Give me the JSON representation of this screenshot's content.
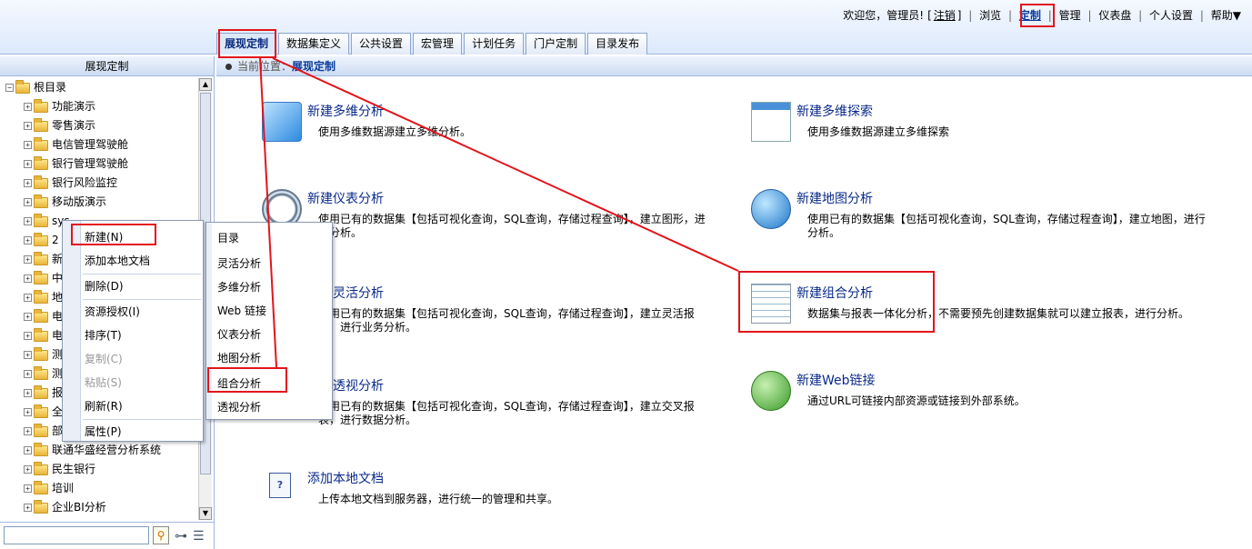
{
  "header": {
    "welcome": "欢迎您，管理员!",
    "logout_open": "[",
    "logout": "注销",
    "logout_close": "]",
    "links": [
      "浏览",
      "定制",
      "管理",
      "仪表盘",
      "个人设置",
      "帮助▼"
    ],
    "active_link": "定制"
  },
  "tabs": [
    "展现定制",
    "数据集定义",
    "公共设置",
    "宏管理",
    "计划任务",
    "门户定制",
    "目录发布"
  ],
  "active_tab": "展现定制",
  "sidebar": {
    "title": "展现定制",
    "tree": [
      {
        "label": "根目录",
        "expander": "⊟",
        "level": 0
      },
      {
        "label": "功能演示",
        "expander": "⊞",
        "level": 1
      },
      {
        "label": "零售演示",
        "expander": "⊞",
        "level": 1
      },
      {
        "label": "电信管理驾驶舱",
        "expander": "⊞",
        "level": 1
      },
      {
        "label": "银行管理驾驶舱",
        "expander": "⊞",
        "level": 1
      },
      {
        "label": "银行风险监控",
        "expander": "⊞",
        "level": 1
      },
      {
        "label": "移动版演示",
        "expander": "⊞",
        "level": 1
      },
      {
        "label": "sys...",
        "expander": "⊞",
        "level": 1
      },
      {
        "label": "2",
        "expander": "⊞",
        "level": 1
      },
      {
        "label": "新",
        "expander": "⊞",
        "level": 1
      },
      {
        "label": "中",
        "expander": "⊞",
        "level": 1
      },
      {
        "label": "地",
        "expander": "⊞",
        "level": 1
      },
      {
        "label": "电",
        "expander": "⊞",
        "level": 1
      },
      {
        "label": "电",
        "expander": "⊞",
        "level": 1
      },
      {
        "label": "测",
        "expander": "⊞",
        "level": 1
      },
      {
        "label": "测",
        "expander": "⊞",
        "level": 1
      },
      {
        "label": "报",
        "expander": "⊞",
        "level": 1
      },
      {
        "label": "全",
        "expander": "⊞",
        "level": 1
      },
      {
        "label": "部",
        "expander": "⊞",
        "level": 1
      },
      {
        "label": "联通华盛经营分析系统",
        "expander": "⊞",
        "level": 1
      },
      {
        "label": "民生银行",
        "expander": "⊞",
        "level": 1
      },
      {
        "label": "培训",
        "expander": "⊞",
        "level": 1
      },
      {
        "label": "企业BI分析",
        "expander": "⊞",
        "level": 1
      }
    ]
  },
  "breadcrumb": {
    "label": "当前位置：",
    "current": "展现定制"
  },
  "cards": [
    {
      "title": "新建多维分析",
      "desc": "使用多维数据源建立多维分析。",
      "icon": "olap-cube-icon"
    },
    {
      "title": "新建多维探索",
      "desc": "使用多维数据源建立多维探索",
      "icon": "explore-window-icon"
    },
    {
      "title": "新建仪表分析",
      "desc": "使用已有的数据集【包括可视化查询，SQL查询，存储过程查询】，建立图形，进行分析。",
      "icon": "gauge-icon"
    },
    {
      "title": "新建地图分析",
      "desc": "使用已有的数据集【包括可视化查询，SQL查询，存储过程查询】，建立地图，进行分析。",
      "icon": "globe-icon"
    },
    {
      "title": "新建灵活分析",
      "desc": "使用已有的数据集【包括可视化查询，SQL查询，存储过程查询】，建立灵活报表，进行业务分析。",
      "icon": "flexible-icon"
    },
    {
      "title": "新建组合分析",
      "desc": "数据集与报表一体化分析，不需要预先创建数据集就可以建立报表，进行分析。",
      "icon": "combo-grid-icon"
    },
    {
      "title": "新建透视分析",
      "desc": "使用已有的数据集【包括可视化查询，SQL查询，存储过程查询】，建立交叉报表，进行数据分析。",
      "icon": "pivot-icon"
    },
    {
      "title": "新建Web链接",
      "desc": "通过URL可链接内部资源或链接到外部系统。",
      "icon": "web-link-icon"
    },
    {
      "title": "添加本地文档",
      "desc": "上传本地文档到服务器，进行统一的管理和共享。",
      "icon": "local-doc-icon"
    }
  ],
  "context_menu": [
    {
      "label": "新建(N)",
      "disabled": false
    },
    {
      "label": "添加本地文档",
      "disabled": false
    },
    {
      "label": "删除(D)",
      "disabled": false
    },
    {
      "label": "资源授权(I)",
      "disabled": false
    },
    {
      "label": "排序(T)",
      "disabled": false
    },
    {
      "label": "复制(C)",
      "disabled": true
    },
    {
      "label": "粘贴(S)",
      "disabled": true
    },
    {
      "label": "刷新(R)",
      "disabled": false
    },
    {
      "label": "属性(P)",
      "disabled": false
    }
  ],
  "sub_menu": [
    "目录",
    "灵活分析",
    "多维分析",
    "Web 链接",
    "仪表分析",
    "地图分析",
    "组合分析",
    "透视分析"
  ],
  "doc_icon_glyph": "?",
  "annotation_color": "#e3141b"
}
